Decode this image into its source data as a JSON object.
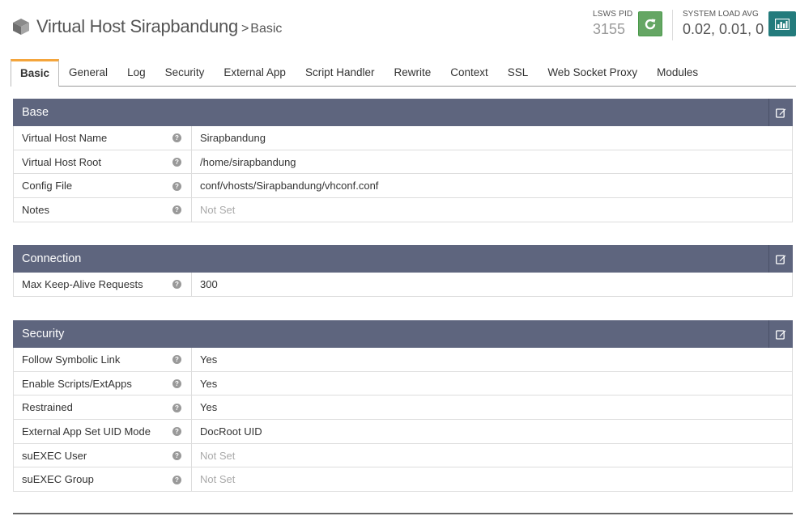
{
  "header": {
    "title": "Virtual Host Sirapbandung",
    "separator": ">",
    "subtitle": "Basic",
    "pid_label": "LSWS PID",
    "pid_value": "3155",
    "load_label": "SYSTEM LOAD AVG",
    "load_value": "0.02, 0.01, 0",
    "restart_icon": "refresh-icon",
    "stats_icon": "bar-chart-icon"
  },
  "tabs": [
    {
      "label": "Basic",
      "active": true
    },
    {
      "label": "General"
    },
    {
      "label": "Log"
    },
    {
      "label": "Security"
    },
    {
      "label": "External App"
    },
    {
      "label": "Script Handler"
    },
    {
      "label": "Rewrite"
    },
    {
      "label": "Context"
    },
    {
      "label": "SSL"
    },
    {
      "label": "Web Socket Proxy"
    },
    {
      "label": "Modules"
    }
  ],
  "panels": {
    "base": {
      "title": "Base",
      "rows": [
        {
          "label": "Virtual Host Name",
          "value": "Sirapbandung"
        },
        {
          "label": "Virtual Host Root",
          "value": "/home/sirapbandung"
        },
        {
          "label": "Config File",
          "value": "conf/vhosts/Sirapbandung/vhconf.conf"
        },
        {
          "label": "Notes",
          "value": "Not Set"
        }
      ]
    },
    "connection": {
      "title": "Connection",
      "rows": [
        {
          "label": "Max Keep-Alive Requests",
          "value": "300"
        }
      ]
    },
    "security": {
      "title": "Security",
      "rows": [
        {
          "label": "Follow Symbolic Link",
          "value": "Yes"
        },
        {
          "label": "Enable Scripts/ExtApps",
          "value": "Yes"
        },
        {
          "label": "Restrained",
          "value": "Yes"
        },
        {
          "label": "External App Set UID Mode",
          "value": "DocRoot UID"
        },
        {
          "label": "suEXEC User",
          "value": "Not Set"
        },
        {
          "label": "suEXEC Group",
          "value": "Not Set"
        }
      ]
    }
  },
  "help_glyph": "?",
  "colors": {
    "panel_header": "#5e657e",
    "active_tab_accent": "#f4a53c",
    "restart_button": "#65a664",
    "stats_button": "#237b7c"
  }
}
